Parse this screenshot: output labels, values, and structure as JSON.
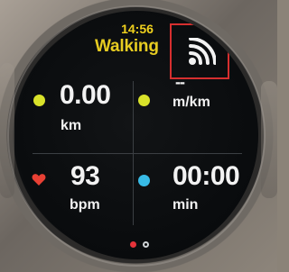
{
  "status": {
    "time": "14:56",
    "activity": "Walking"
  },
  "icons": {
    "signal": "wifi-signal-icon",
    "heart": "heart-icon"
  },
  "metrics": {
    "distance": {
      "value": "0.00",
      "unit": "km",
      "color": "#d9e22a"
    },
    "pace": {
      "value": "--",
      "unit": "m/km",
      "color": "#d9e22a"
    },
    "heart_rate": {
      "value": "93",
      "unit": "bpm",
      "color": "#e84034"
    },
    "duration": {
      "value": "00:00",
      "unit": "min",
      "color": "#38bbe6"
    }
  },
  "pager": {
    "active_color": "#e6333a",
    "inactive_color": "#cfd3d6"
  },
  "highlight": {
    "color": "#d62f2f"
  }
}
